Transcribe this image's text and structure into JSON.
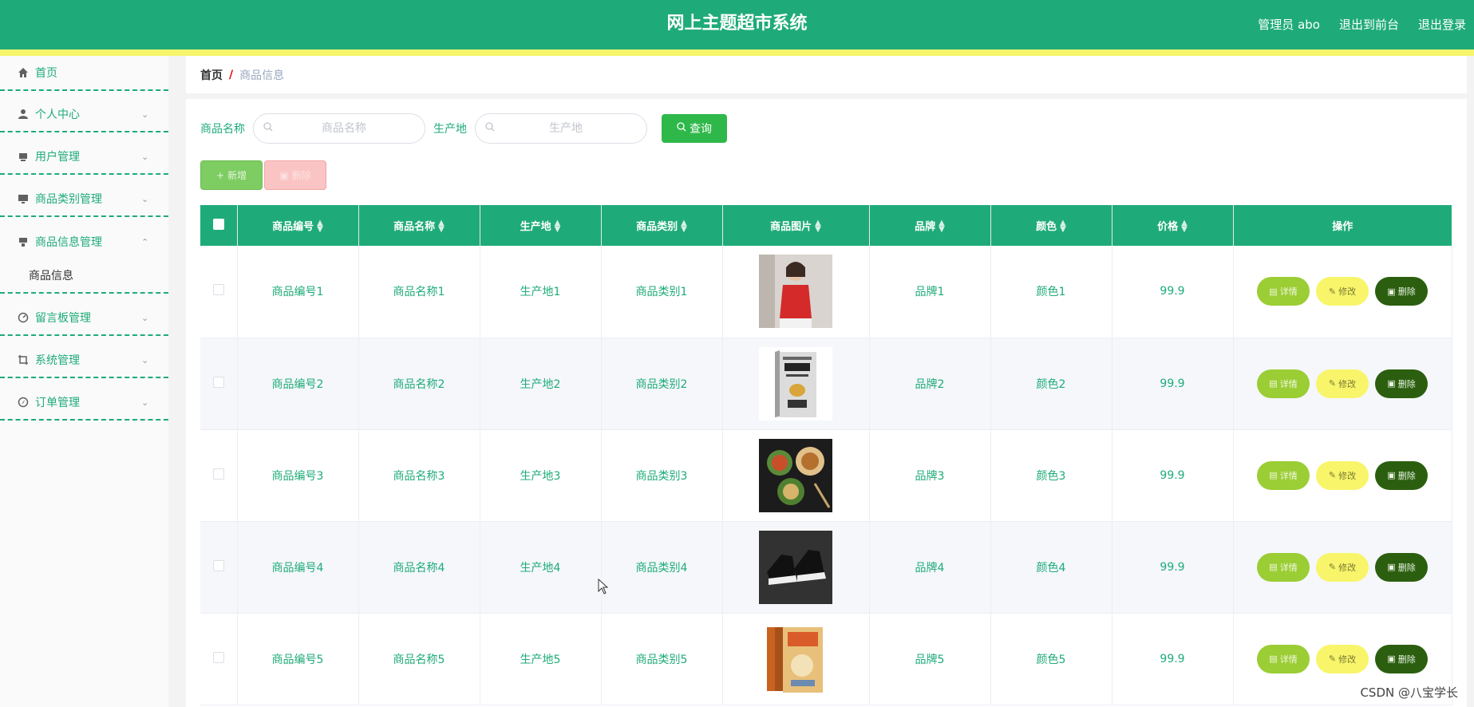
{
  "header": {
    "title": "网上主题超市系统",
    "admin_label": "管理员 abo",
    "exit_front": "退出到前台",
    "logout": "退出登录",
    "bg_color": "#1fab79",
    "stripe_color": "#f6f56b"
  },
  "sidebar": {
    "items": [
      {
        "label": "首页",
        "icon": "home-icon"
      },
      {
        "label": "个人中心",
        "icon": "user-icon"
      },
      {
        "label": "用户管理",
        "icon": "users-icon"
      },
      {
        "label": "商品类别管理",
        "icon": "monitor-icon"
      },
      {
        "label": "商品信息管理",
        "icon": "box-icon"
      },
      {
        "label": "留言板管理",
        "icon": "chat-icon"
      },
      {
        "label": "系统管理",
        "icon": "crop-icon"
      },
      {
        "label": "订单管理",
        "icon": "compass-icon"
      }
    ],
    "submenu": {
      "label": "商品信息"
    }
  },
  "breadcrumb": {
    "home": "首页",
    "separator": "/",
    "current": "商品信息"
  },
  "search": {
    "name_label": "商品名称",
    "name_placeholder": "商品名称",
    "origin_label": "生产地",
    "origin_placeholder": "生产地",
    "query_button": "查询"
  },
  "actions": {
    "add": "新增",
    "delete": "删除"
  },
  "table": {
    "columns": [
      "商品编号",
      "商品名称",
      "生产地",
      "商品类别",
      "商品图片",
      "品牌",
      "颜色",
      "价格",
      "操作"
    ],
    "rows": [
      {
        "code": "商品编号1",
        "name": "商品名称1",
        "origin": "生产地1",
        "category": "商品类别1",
        "image": "red-top-photo",
        "brand": "品牌1",
        "color": "颜色1",
        "price": "99.9"
      },
      {
        "code": "商品编号2",
        "name": "商品名称2",
        "origin": "生产地2",
        "category": "商品类别2",
        "image": "book-photo",
        "brand": "品牌2",
        "color": "颜色2",
        "price": "99.9"
      },
      {
        "code": "商品编号3",
        "name": "商品名称3",
        "origin": "生产地3",
        "category": "商品类别3",
        "image": "food-bowls-photo",
        "brand": "品牌3",
        "color": "颜色3",
        "price": "99.9"
      },
      {
        "code": "商品编号4",
        "name": "商品名称4",
        "origin": "生产地4",
        "category": "商品类别4",
        "image": "sneakers-photo",
        "brand": "品牌4",
        "color": "颜色4",
        "price": "99.9"
      },
      {
        "code": "商品编号5",
        "name": "商品名称5",
        "origin": "生产地5",
        "category": "商品类别5",
        "image": "idiom-books-photo",
        "brand": "品牌5",
        "color": "颜色5",
        "price": "99.9"
      }
    ],
    "op_labels": {
      "detail": "详情",
      "edit": "修改",
      "delete": "删除"
    }
  },
  "watermark": "CSDN @八宝学长"
}
